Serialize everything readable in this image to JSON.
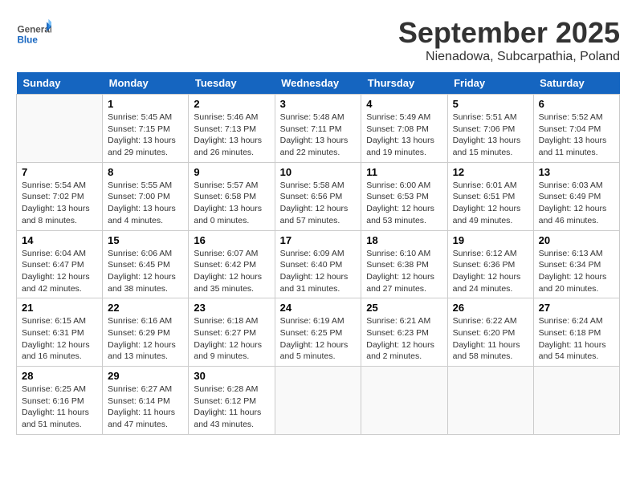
{
  "header": {
    "logo_general": "General",
    "logo_blue": "Blue",
    "month": "September 2025",
    "location": "Nienadowa, Subcarpathia, Poland"
  },
  "days_of_week": [
    "Sunday",
    "Monday",
    "Tuesday",
    "Wednesday",
    "Thursday",
    "Friday",
    "Saturday"
  ],
  "weeks": [
    [
      {
        "day": "",
        "info": ""
      },
      {
        "day": "1",
        "info": "Sunrise: 5:45 AM\nSunset: 7:15 PM\nDaylight: 13 hours\nand 29 minutes."
      },
      {
        "day": "2",
        "info": "Sunrise: 5:46 AM\nSunset: 7:13 PM\nDaylight: 13 hours\nand 26 minutes."
      },
      {
        "day": "3",
        "info": "Sunrise: 5:48 AM\nSunset: 7:11 PM\nDaylight: 13 hours\nand 22 minutes."
      },
      {
        "day": "4",
        "info": "Sunrise: 5:49 AM\nSunset: 7:08 PM\nDaylight: 13 hours\nand 19 minutes."
      },
      {
        "day": "5",
        "info": "Sunrise: 5:51 AM\nSunset: 7:06 PM\nDaylight: 13 hours\nand 15 minutes."
      },
      {
        "day": "6",
        "info": "Sunrise: 5:52 AM\nSunset: 7:04 PM\nDaylight: 13 hours\nand 11 minutes."
      }
    ],
    [
      {
        "day": "7",
        "info": "Sunrise: 5:54 AM\nSunset: 7:02 PM\nDaylight: 13 hours\nand 8 minutes."
      },
      {
        "day": "8",
        "info": "Sunrise: 5:55 AM\nSunset: 7:00 PM\nDaylight: 13 hours\nand 4 minutes."
      },
      {
        "day": "9",
        "info": "Sunrise: 5:57 AM\nSunset: 6:58 PM\nDaylight: 13 hours\nand 0 minutes."
      },
      {
        "day": "10",
        "info": "Sunrise: 5:58 AM\nSunset: 6:56 PM\nDaylight: 12 hours\nand 57 minutes."
      },
      {
        "day": "11",
        "info": "Sunrise: 6:00 AM\nSunset: 6:53 PM\nDaylight: 12 hours\nand 53 minutes."
      },
      {
        "day": "12",
        "info": "Sunrise: 6:01 AM\nSunset: 6:51 PM\nDaylight: 12 hours\nand 49 minutes."
      },
      {
        "day": "13",
        "info": "Sunrise: 6:03 AM\nSunset: 6:49 PM\nDaylight: 12 hours\nand 46 minutes."
      }
    ],
    [
      {
        "day": "14",
        "info": "Sunrise: 6:04 AM\nSunset: 6:47 PM\nDaylight: 12 hours\nand 42 minutes."
      },
      {
        "day": "15",
        "info": "Sunrise: 6:06 AM\nSunset: 6:45 PM\nDaylight: 12 hours\nand 38 minutes."
      },
      {
        "day": "16",
        "info": "Sunrise: 6:07 AM\nSunset: 6:42 PM\nDaylight: 12 hours\nand 35 minutes."
      },
      {
        "day": "17",
        "info": "Sunrise: 6:09 AM\nSunset: 6:40 PM\nDaylight: 12 hours\nand 31 minutes."
      },
      {
        "day": "18",
        "info": "Sunrise: 6:10 AM\nSunset: 6:38 PM\nDaylight: 12 hours\nand 27 minutes."
      },
      {
        "day": "19",
        "info": "Sunrise: 6:12 AM\nSunset: 6:36 PM\nDaylight: 12 hours\nand 24 minutes."
      },
      {
        "day": "20",
        "info": "Sunrise: 6:13 AM\nSunset: 6:34 PM\nDaylight: 12 hours\nand 20 minutes."
      }
    ],
    [
      {
        "day": "21",
        "info": "Sunrise: 6:15 AM\nSunset: 6:31 PM\nDaylight: 12 hours\nand 16 minutes."
      },
      {
        "day": "22",
        "info": "Sunrise: 6:16 AM\nSunset: 6:29 PM\nDaylight: 12 hours\nand 13 minutes."
      },
      {
        "day": "23",
        "info": "Sunrise: 6:18 AM\nSunset: 6:27 PM\nDaylight: 12 hours\nand 9 minutes."
      },
      {
        "day": "24",
        "info": "Sunrise: 6:19 AM\nSunset: 6:25 PM\nDaylight: 12 hours\nand 5 minutes."
      },
      {
        "day": "25",
        "info": "Sunrise: 6:21 AM\nSunset: 6:23 PM\nDaylight: 12 hours\nand 2 minutes."
      },
      {
        "day": "26",
        "info": "Sunrise: 6:22 AM\nSunset: 6:20 PM\nDaylight: 11 hours\nand 58 minutes."
      },
      {
        "day": "27",
        "info": "Sunrise: 6:24 AM\nSunset: 6:18 PM\nDaylight: 11 hours\nand 54 minutes."
      }
    ],
    [
      {
        "day": "28",
        "info": "Sunrise: 6:25 AM\nSunset: 6:16 PM\nDaylight: 11 hours\nand 51 minutes."
      },
      {
        "day": "29",
        "info": "Sunrise: 6:27 AM\nSunset: 6:14 PM\nDaylight: 11 hours\nand 47 minutes."
      },
      {
        "day": "30",
        "info": "Sunrise: 6:28 AM\nSunset: 6:12 PM\nDaylight: 11 hours\nand 43 minutes."
      },
      {
        "day": "",
        "info": ""
      },
      {
        "day": "",
        "info": ""
      },
      {
        "day": "",
        "info": ""
      },
      {
        "day": "",
        "info": ""
      }
    ]
  ]
}
